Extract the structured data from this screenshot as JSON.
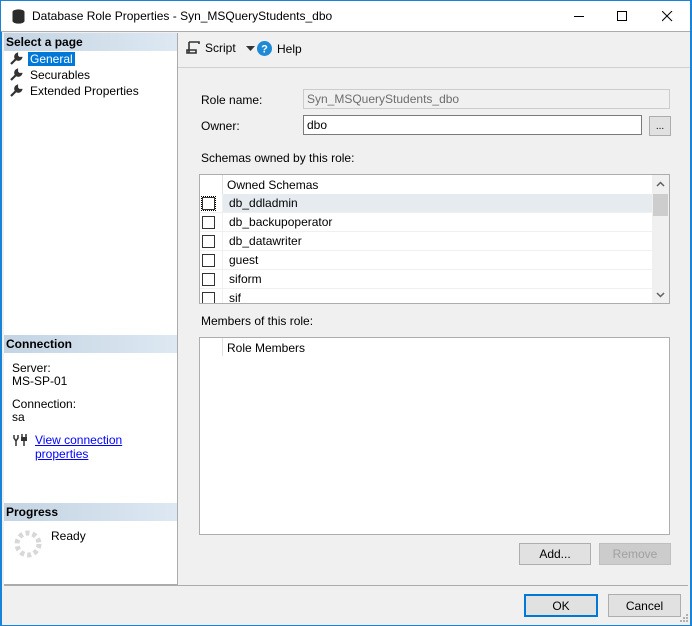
{
  "window": {
    "title": "Database Role Properties - Syn_MSQueryStudents_dbo",
    "icon": "database-icon",
    "controls": [
      "minimize",
      "maximize",
      "close"
    ]
  },
  "left_panel": {
    "select_page": {
      "header": "Select a page",
      "items": [
        {
          "label": "General",
          "icon": "wrench-icon",
          "active": true
        },
        {
          "label": "Securables",
          "icon": "wrench-icon",
          "active": false
        },
        {
          "label": "Extended Properties",
          "icon": "wrench-icon",
          "active": false
        }
      ]
    },
    "connection": {
      "header": "Connection",
      "server_label": "Server:",
      "server_value": "MS-SP-01",
      "connection_label": "Connection:",
      "connection_value": "sa",
      "view_link": "View connection properties"
    },
    "progress": {
      "header": "Progress",
      "status": "Ready"
    }
  },
  "toolbar": {
    "script_label": "Script",
    "help_label": "Help"
  },
  "form": {
    "role_name_label": "Role name:",
    "role_name_value": "Syn_MSQueryStudents_dbo",
    "owner_label": "Owner:",
    "owner_value": "dbo",
    "browse_label": "...",
    "schemas_label": "Schemas owned by this role:",
    "schemas_header": "Owned Schemas",
    "schemas": [
      {
        "name": "db_ddladmin",
        "checked": false,
        "selected": true
      },
      {
        "name": "db_backupoperator",
        "checked": false,
        "selected": false
      },
      {
        "name": "db_datawriter",
        "checked": false,
        "selected": false
      },
      {
        "name": "guest",
        "checked": false,
        "selected": false
      },
      {
        "name": "siform",
        "checked": false,
        "selected": false
      },
      {
        "name": "sif",
        "checked": false,
        "selected": false
      }
    ],
    "members_label": "Members of this role:",
    "members_header": "Role Members",
    "members": [],
    "add_label": "Add...",
    "remove_label": "Remove"
  },
  "footer": {
    "ok_label": "OK",
    "cancel_label": "Cancel"
  }
}
